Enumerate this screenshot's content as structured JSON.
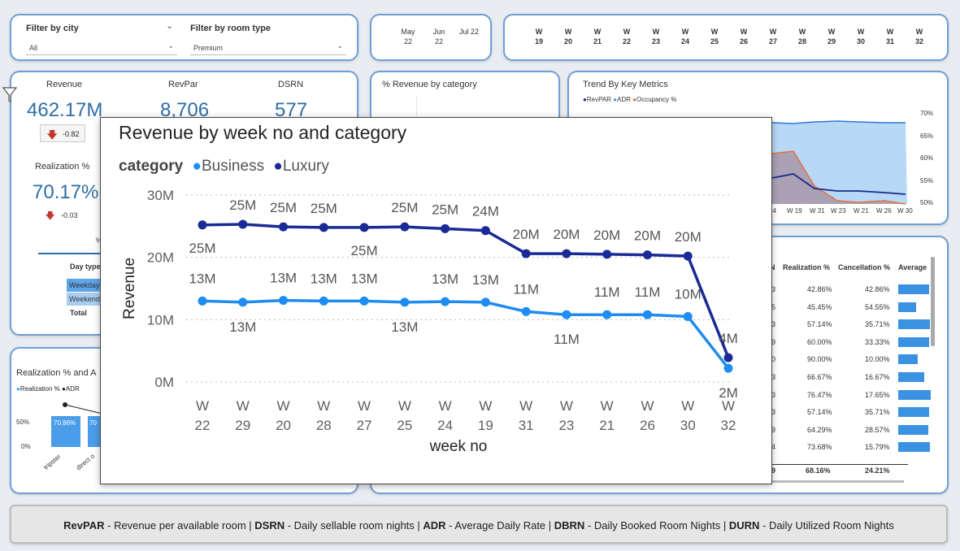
{
  "filters": {
    "city_label": "Filter by city",
    "city_value": "All",
    "room_label": "Filter by room type",
    "room_value": "Premium"
  },
  "months": [
    {
      "m": "May",
      "y": "22"
    },
    {
      "m": "Jun",
      "y": "22"
    },
    {
      "m": "Jul 22",
      "y": ""
    }
  ],
  "weeks": [
    "19",
    "20",
    "21",
    "22",
    "23",
    "24",
    "25",
    "26",
    "27",
    "28",
    "29",
    "30",
    "31",
    "32"
  ],
  "week_prefix": "W",
  "kpis": {
    "revenue_title": "Revenue",
    "revenue_value": "462.17M",
    "revenue_delta": "-0.82",
    "revpar_title": "RevPar",
    "revpar_value": "8,706",
    "dsrn_title": "DSRN",
    "dsrn_value": "577",
    "realization_title": "Realization %",
    "realization_value": "70.17%",
    "realization_delta": "-0.03",
    "pct_fragment": "%"
  },
  "daytype": {
    "header": "Day type",
    "rows": [
      "Weekday",
      "Weekend"
    ],
    "total": "Total"
  },
  "rev_by_category_title": "% Revenue by category",
  "trend": {
    "title": "Trend By Key Metrics",
    "legend": [
      "RevPAR",
      "ADR",
      "Occupancy %"
    ],
    "legend_colors": [
      "#1a2a8a",
      "#3aa0f0",
      "#e8703a"
    ],
    "yticks": [
      "70%",
      "65%",
      "60%",
      "55%",
      "50%"
    ],
    "xticks": [
      "24",
      "W 19",
      "W 31",
      "W 23",
      "W 21",
      "W 26",
      "W 30"
    ]
  },
  "realization_adr": {
    "title": "Realization % and A",
    "legend": [
      "Realization %",
      "ADR"
    ],
    "yticks": [
      "50%",
      "0%"
    ],
    "bar_labels": [
      "70.86%",
      "70"
    ],
    "xticks": [
      "tripster",
      "direct o"
    ]
  },
  "table": {
    "headers": [
      "N",
      "Realization %",
      "Cancellation %",
      "Average"
    ],
    "rows": [
      {
        "n": "3",
        "real": "42.86%",
        "canc": "42.86%",
        "avg": 0.95
      },
      {
        "n": "5",
        "real": "45.45%",
        "canc": "54.55%",
        "avg": 0.55
      },
      {
        "n": "3",
        "real": "57.14%",
        "canc": "35.71%",
        "avg": 0.97
      },
      {
        "n": "9",
        "real": "60.00%",
        "canc": "33.33%",
        "avg": 0.95
      },
      {
        "n": "0",
        "real": "90.00%",
        "canc": "10.00%",
        "avg": 0.6
      },
      {
        "n": "3",
        "real": "66.67%",
        "canc": "16.67%",
        "avg": 0.8
      },
      {
        "n": "3",
        "real": "76.47%",
        "canc": "17.65%",
        "avg": 1.0
      },
      {
        "n": "3",
        "real": "57.14%",
        "canc": "35.71%",
        "avg": 0.95
      },
      {
        "n": "9",
        "real": "64.29%",
        "canc": "28.57%",
        "avg": 0.93
      },
      {
        "n": "4",
        "real": "73.68%",
        "canc": "15.79%",
        "avg": 0.97
      }
    ],
    "total": {
      "n": "9",
      "real": "68.16%",
      "canc": "24.21%"
    }
  },
  "footer": {
    "t1": "RevPAR",
    "d1": " - Revenue per available room | ",
    "t2": "DSRN",
    "d2": " - Daily sellable room nights | ",
    "t3": "ADR",
    "d3": " - Average Daily Rate | ",
    "t4": "DBRN",
    "d4": " - Daily Booked Room Nights | ",
    "t5": "DURN",
    "d5": " - Daily Utilized Room Nights"
  },
  "chart_data": {
    "type": "line",
    "title": "Revenue by week no and category",
    "legend_title": "category",
    "xlabel": "week no",
    "ylabel": "Revenue",
    "ylim": [
      0,
      30
    ],
    "yticks": [
      "0M",
      "10M",
      "20M",
      "30M"
    ],
    "categories": [
      "W 22",
      "W 29",
      "W 20",
      "W 28",
      "W 27",
      "W 25",
      "W 24",
      "W 19",
      "W 31",
      "W 23",
      "W 21",
      "W 26",
      "W 30",
      "W 32"
    ],
    "series": [
      {
        "name": "Luxury",
        "color": "#1a2a96",
        "values": [
          25.2,
          25.3,
          24.9,
          24.8,
          24.8,
          24.9,
          24.6,
          24.3,
          20.6,
          20.6,
          20.5,
          20.4,
          20.2,
          3.9
        ],
        "labels": [
          "25M",
          "25M",
          "25M",
          "25M",
          "25M",
          "25M",
          "25M",
          "24M",
          "20M",
          "20M",
          "20M",
          "20M",
          "20M",
          "4M"
        ]
      },
      {
        "name": "Business",
        "color": "#1e8cf0",
        "values": [
          13.0,
          12.8,
          13.1,
          13.0,
          13.0,
          12.8,
          12.9,
          12.8,
          11.3,
          10.8,
          10.8,
          10.8,
          10.5,
          2.2
        ],
        "labels": [
          "13M",
          "13M",
          "13M",
          "13M",
          "13M",
          "13M",
          "13M",
          "13M",
          "11M",
          "11M",
          "11M",
          "11M",
          "10M",
          "2M"
        ]
      }
    ],
    "grid": true,
    "legend_position": "top-left"
  }
}
